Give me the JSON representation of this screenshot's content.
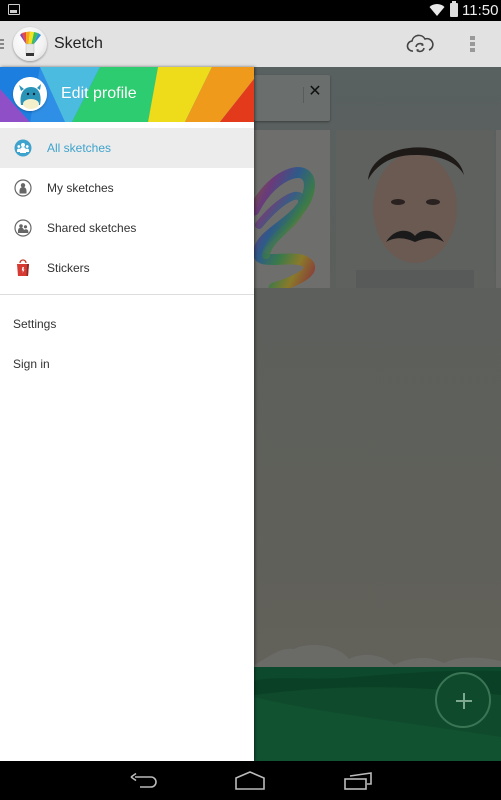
{
  "status_bar": {
    "time": "11:50",
    "icons": [
      "notification-image-icon",
      "wifi-icon",
      "battery-icon"
    ]
  },
  "action_bar": {
    "title": "Sketch",
    "icons": {
      "drawer_toggle": "menu-lines-icon",
      "logo": "sketch-brush-logo",
      "sync": "cloud-sync-icon",
      "overflow": "overflow-menu-icon"
    }
  },
  "drawer": {
    "header": {
      "label": "Edit profile",
      "avatar_icon": "monster-avatar-icon"
    },
    "items": [
      {
        "label": "All sketches",
        "icon": "group-icon",
        "active": true
      },
      {
        "label": "My sketches",
        "icon": "person-icon",
        "active": false
      },
      {
        "label": "Shared sketches",
        "icon": "shared-people-icon",
        "active": false
      },
      {
        "label": "Stickers",
        "icon": "shopping-bag-icon",
        "active": false
      }
    ],
    "secondary_items": [
      {
        "label": "Settings"
      },
      {
        "label": "Sign in"
      }
    ]
  },
  "main": {
    "banner_close_label": "✕",
    "thumbnails": [
      {
        "kind": "rainbow-scribble-sketch"
      },
      {
        "kind": "photo-with-mustache-sticker"
      }
    ],
    "fab_icon": "plus-icon"
  },
  "colors": {
    "accent": "#3ea3cd",
    "active_row": "#ececec",
    "action_bar": "#e2e2e2",
    "scrim": "#5c5f5b",
    "hills": "#0f4a2c"
  },
  "nav_bar": {
    "icons": [
      "back-icon",
      "home-icon",
      "recents-icon"
    ]
  }
}
